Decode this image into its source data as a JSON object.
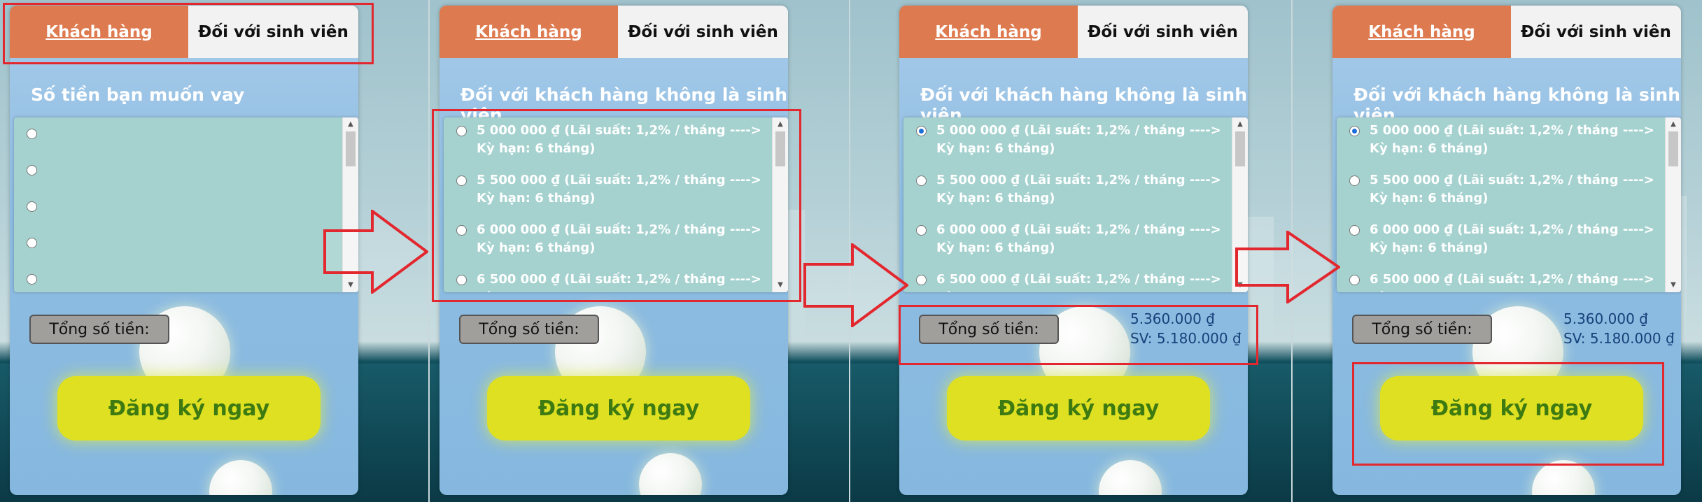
{
  "panels": [
    {
      "tabs": {
        "customer": "Khách hàng",
        "student": "Đối với sinh viên"
      },
      "subtitle": "Số tiền bạn muốn vay",
      "options": [
        {
          "label": "",
          "checked": false
        },
        {
          "label": "",
          "checked": false
        },
        {
          "label": "",
          "checked": false
        },
        {
          "label": "",
          "checked": false
        },
        {
          "label": "",
          "checked": false
        }
      ],
      "total_label": "Tổng số tiền:",
      "amount": "",
      "student_amount": "",
      "register_label": "Đăng ký ngay"
    },
    {
      "tabs": {
        "customer": "Khách hàng",
        "student": "Đối với sinh viên"
      },
      "subtitle": "Đối với khách hàng không là sinh viên",
      "options": [
        {
          "label": "5 000 000 ₫ (Lãi suất: 1,2% / tháng ----> Kỳ hạn: 6 tháng)",
          "checked": false
        },
        {
          "label": "5 500 000 ₫ (Lãi suất: 1,2% / tháng ----> Kỳ hạn: 6 tháng)",
          "checked": false
        },
        {
          "label": "6 000 000 ₫ (Lãi suất: 1,2% / tháng ----> Kỳ hạn: 6 tháng)",
          "checked": false
        },
        {
          "label": "6 500 000 ₫ (Lãi suất: 1,2% / tháng ----> Kỳ",
          "checked": false
        }
      ],
      "total_label": "Tổng số tiền:",
      "amount": "",
      "student_amount": "",
      "register_label": "Đăng ký ngay"
    },
    {
      "tabs": {
        "customer": "Khách hàng",
        "student": "Đối với sinh viên"
      },
      "subtitle": "Đối với khách hàng không là sinh viên",
      "options": [
        {
          "label": "5 000 000 ₫ (Lãi suất: 1,2% / tháng ----> Kỳ hạn: 6 tháng)",
          "checked": true
        },
        {
          "label": "5 500 000 ₫ (Lãi suất: 1,2% / tháng ----> Kỳ hạn: 6 tháng)",
          "checked": false
        },
        {
          "label": "6 000 000 ₫ (Lãi suất: 1,2% / tháng ----> Kỳ hạn: 6 tháng)",
          "checked": false
        },
        {
          "label": "6 500 000 ₫ (Lãi suất: 1,2% / tháng ----> Kỳ",
          "checked": false
        }
      ],
      "total_label": "Tổng số tiền:",
      "amount": "5.360.000 ₫",
      "student_amount": "SV: 5.180.000 ₫",
      "register_label": "Đăng ký ngay"
    },
    {
      "tabs": {
        "customer": "Khách hàng",
        "student": "Đối với sinh viên"
      },
      "subtitle": "Đối với khách hàng không là sinh viên",
      "options": [
        {
          "label": "5 000 000 ₫ (Lãi suất: 1,2% / tháng ----> Kỳ hạn: 6 tháng)",
          "checked": true
        },
        {
          "label": "5 500 000 ₫ (Lãi suất: 1,2% / tháng ----> Kỳ hạn: 6 tháng)",
          "checked": false
        },
        {
          "label": "6 000 000 ₫ (Lãi suất: 1,2% / tháng ----> Kỳ hạn: 6 tháng)",
          "checked": false
        },
        {
          "label": "6 500 000 ₫ (Lãi suất: 1,2% / tháng ----> Kỳ",
          "checked": false
        }
      ],
      "total_label": "Tổng số tiền:",
      "amount": "5.360.000 ₫",
      "student_amount": "SV: 5.180.000 ₫",
      "register_label": "Đăng ký ngay"
    }
  ],
  "colors": {
    "tab_active": "#de7a4f",
    "register_button": "#dfe021",
    "register_text": "#3e7a12",
    "highlight": "#e3272e"
  }
}
